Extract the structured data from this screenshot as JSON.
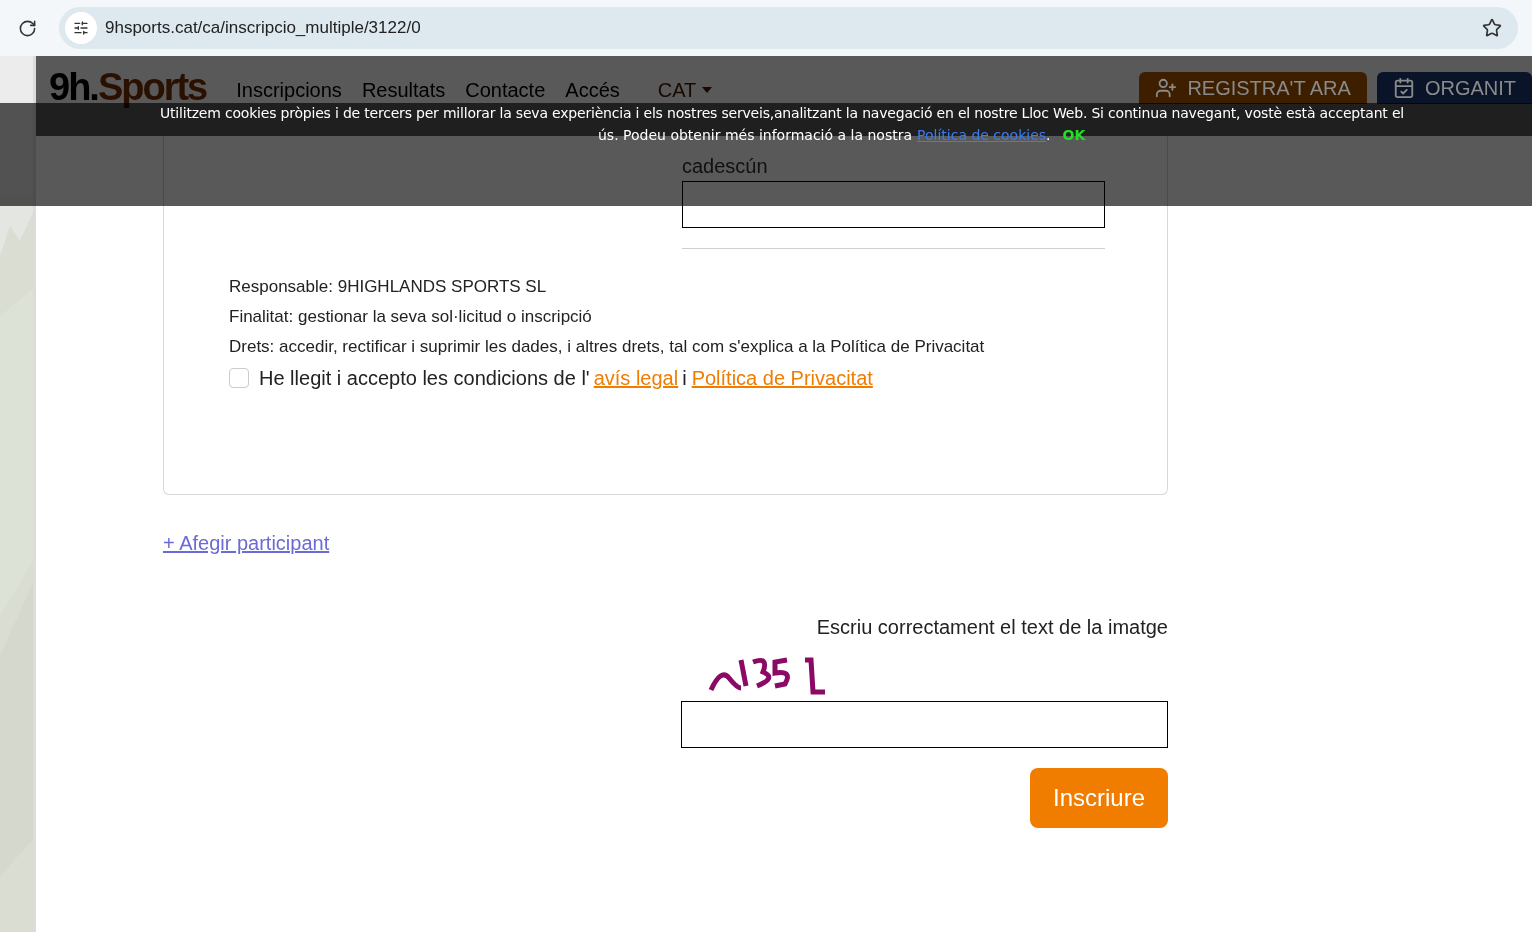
{
  "browser": {
    "url": "9hsports.cat/ca/inscripcio_multiple/3122/0"
  },
  "header": {
    "logo_prefix": "9h.",
    "logo_suffix": "Sports",
    "nav": [
      "Inscripcions",
      "Resultats",
      "Contacte",
      "Accés"
    ],
    "language": "CAT",
    "buttons": [
      {
        "label": "REGISTRA'T ARA",
        "kind": "register"
      },
      {
        "label": "ORGANIT",
        "kind": "organize"
      }
    ]
  },
  "cookie_banner": {
    "line_1": "Utilitzem cookies pròpies i de tercers per millorar la seva experiència i els nostres serveis,analitzant la navegació en el nostre Lloc Web. Si continua navegant, vostè està acceptant el",
    "line_2": "ús. Podeu obtenir més informació a la nostra",
    "link": "Política de cookies",
    "after_link": ".",
    "ok": "OK"
  },
  "form": {
    "field_label": "cadescún",
    "privacy": [
      "Responsable: 9HIGHLANDS SPORTS SL",
      "Finalitat: gestionar la seva sol·licitud o inscripció",
      "Drets: accedir, rectificar i suprimir les dades, i altres drets, tal com s'explica a la Política de Privacitat"
    ],
    "consent": {
      "checked": false,
      "text": "He llegit i accepto les condicions de l'",
      "link_1": "avís legal",
      "middle": "i",
      "link_2": "Política de Privacitat"
    }
  },
  "add_participant": "+ Afegir participant",
  "captcha": {
    "label": "Escriu correctament el text de la imatge",
    "kind": "picture"
  },
  "submit": "Inscriure"
}
